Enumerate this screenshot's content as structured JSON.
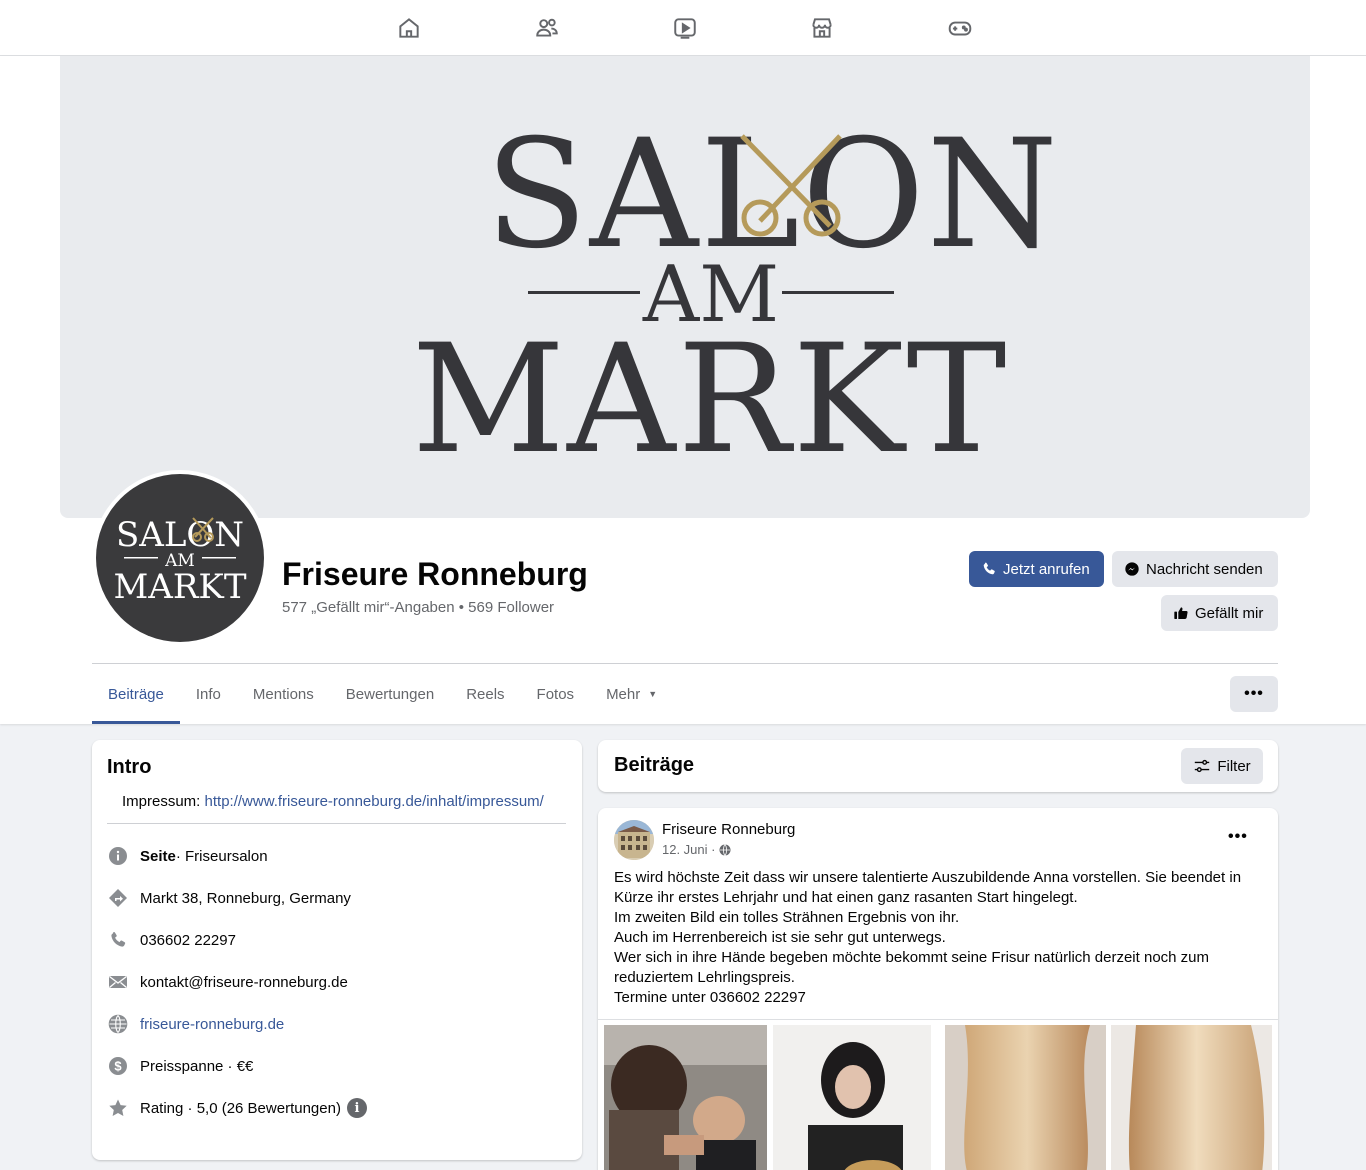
{
  "nav": {
    "icons": [
      "home-icon",
      "friends-icon",
      "watch-icon",
      "marketplace-icon",
      "gaming-icon"
    ]
  },
  "cover": {
    "logo_line1": "SALON",
    "logo_line2": "AM",
    "logo_line3": "MARKT",
    "text_color": "#36363a",
    "accent_color": "#b59a5a"
  },
  "profile": {
    "name": "Friseure Ronneburg",
    "stats": "577 „Gefällt mir“-Angaben • 569 Follower"
  },
  "actions": {
    "call_label": "Jetzt anrufen",
    "message_label": "Nachricht senden",
    "like_label": "Gefällt mir"
  },
  "tabs": {
    "items": [
      {
        "label": "Beiträge"
      },
      {
        "label": "Info"
      },
      {
        "label": "Mentions"
      },
      {
        "label": "Bewertungen"
      },
      {
        "label": "Reels"
      },
      {
        "label": "Fotos"
      },
      {
        "label": "Mehr"
      }
    ],
    "more_dots": "•••"
  },
  "intro": {
    "title": "Intro",
    "impressum_label": "Impressum:",
    "impressum_link": "http://www.friseure-ronneburg.de/inhalt/impressum/",
    "page_type_bold": "Seite",
    "page_type_rest": " · Friseursalon",
    "address": "Markt 38, Ronneburg, Germany",
    "phone": "036602 22297",
    "email": "kontakt@friseure-ronneburg.de",
    "website": "friseure-ronneburg.de",
    "price": "Preisspanne · €€",
    "rating": "Rating · 5,0 (26 Bewertungen)",
    "rating_info": "i"
  },
  "posts": {
    "title": "Beiträge",
    "filter_label": "Filter",
    "post": {
      "author": "Friseure Ronneburg",
      "date": "12. Juni ·",
      "more": "•••",
      "lines": [
        "Es wird höchste Zeit dass wir unsere talentierte Auszubildende Anna vorstellen. Sie beendet in Kürze ihr erstes Lehrjahr und hat einen ganz rasanten Start hingelegt.",
        "Im zweiten Bild ein tolles Strähnen Ergebnis von ihr.",
        "Auch im Herrenbereich ist sie sehr gut unterwegs.",
        "Wer sich in ihre Hände begeben möchte bekommt seine Frisur natürlich derzeit noch zum reduziertem Lehrlingspreis.",
        "Termine unter 036602 22297"
      ]
    }
  },
  "colors": {
    "brand_blue": "#385898",
    "secondary_gray": "#e4e6eb",
    "text_muted": "#65676b"
  }
}
